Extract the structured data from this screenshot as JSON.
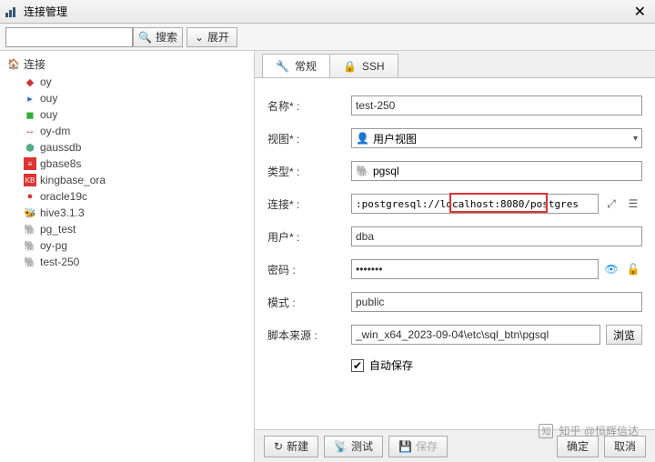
{
  "window": {
    "title": "连接管理",
    "close": "✕"
  },
  "toolbar": {
    "search_placeholder": "",
    "search_btn": "搜索",
    "expand_btn": "展开"
  },
  "sidebar": {
    "root": "连接",
    "items": [
      {
        "icon": "◆",
        "cls": "c-red",
        "label": "oy"
      },
      {
        "icon": "▸",
        "cls": "c-blue",
        "label": "ouy"
      },
      {
        "icon": "◼",
        "cls": "c-green",
        "label": "ouy"
      },
      {
        "icon": "↔",
        "cls": "c-red",
        "label": "oy-dm"
      },
      {
        "icon": "⬢",
        "cls": "c-db",
        "label": "gaussdb"
      },
      {
        "icon": "≡",
        "cls": "c-redbg",
        "label": "gbase8s"
      },
      {
        "icon": "KB",
        "cls": "c-redbg",
        "label": "kingbase_ora"
      },
      {
        "icon": "●",
        "cls": "c-red",
        "label": "oracle19c"
      },
      {
        "icon": "🐝",
        "cls": "c-orange",
        "label": "hive3.1.3"
      },
      {
        "icon": "🐘",
        "cls": "c-cyan",
        "label": "pg_test"
      },
      {
        "icon": "🐘",
        "cls": "c-cyan",
        "label": "oy-pg"
      },
      {
        "icon": "🐘",
        "cls": "c-cyan",
        "label": "test-250"
      }
    ]
  },
  "tabs": {
    "general": "常规",
    "ssh": "SSH"
  },
  "form": {
    "name_label": "名称* :",
    "name_value": "test-250",
    "view_label": "视图* :",
    "view_value": "用户视图",
    "type_label": "类型* :",
    "type_value": "pgsql",
    "conn_label": "连接* :",
    "conn_value": ":postgresql://localhost:8080/postgres",
    "user_label": "用户* :",
    "user_value": "dba",
    "pass_label": "密码 :",
    "pass_value": "•••••••",
    "schema_label": "模式 :",
    "schema_value": "public",
    "script_label": "脚本来源 :",
    "script_value": "_win_x64_2023-09-04\\etc\\sql_btn\\pgsql",
    "browse": "浏览",
    "autosave": "自动保存"
  },
  "footer": {
    "new": "新建",
    "test": "测试",
    "save": "保存",
    "ok": "确定",
    "cancel": "取消"
  },
  "watermark": "知乎 @恒辉信达"
}
